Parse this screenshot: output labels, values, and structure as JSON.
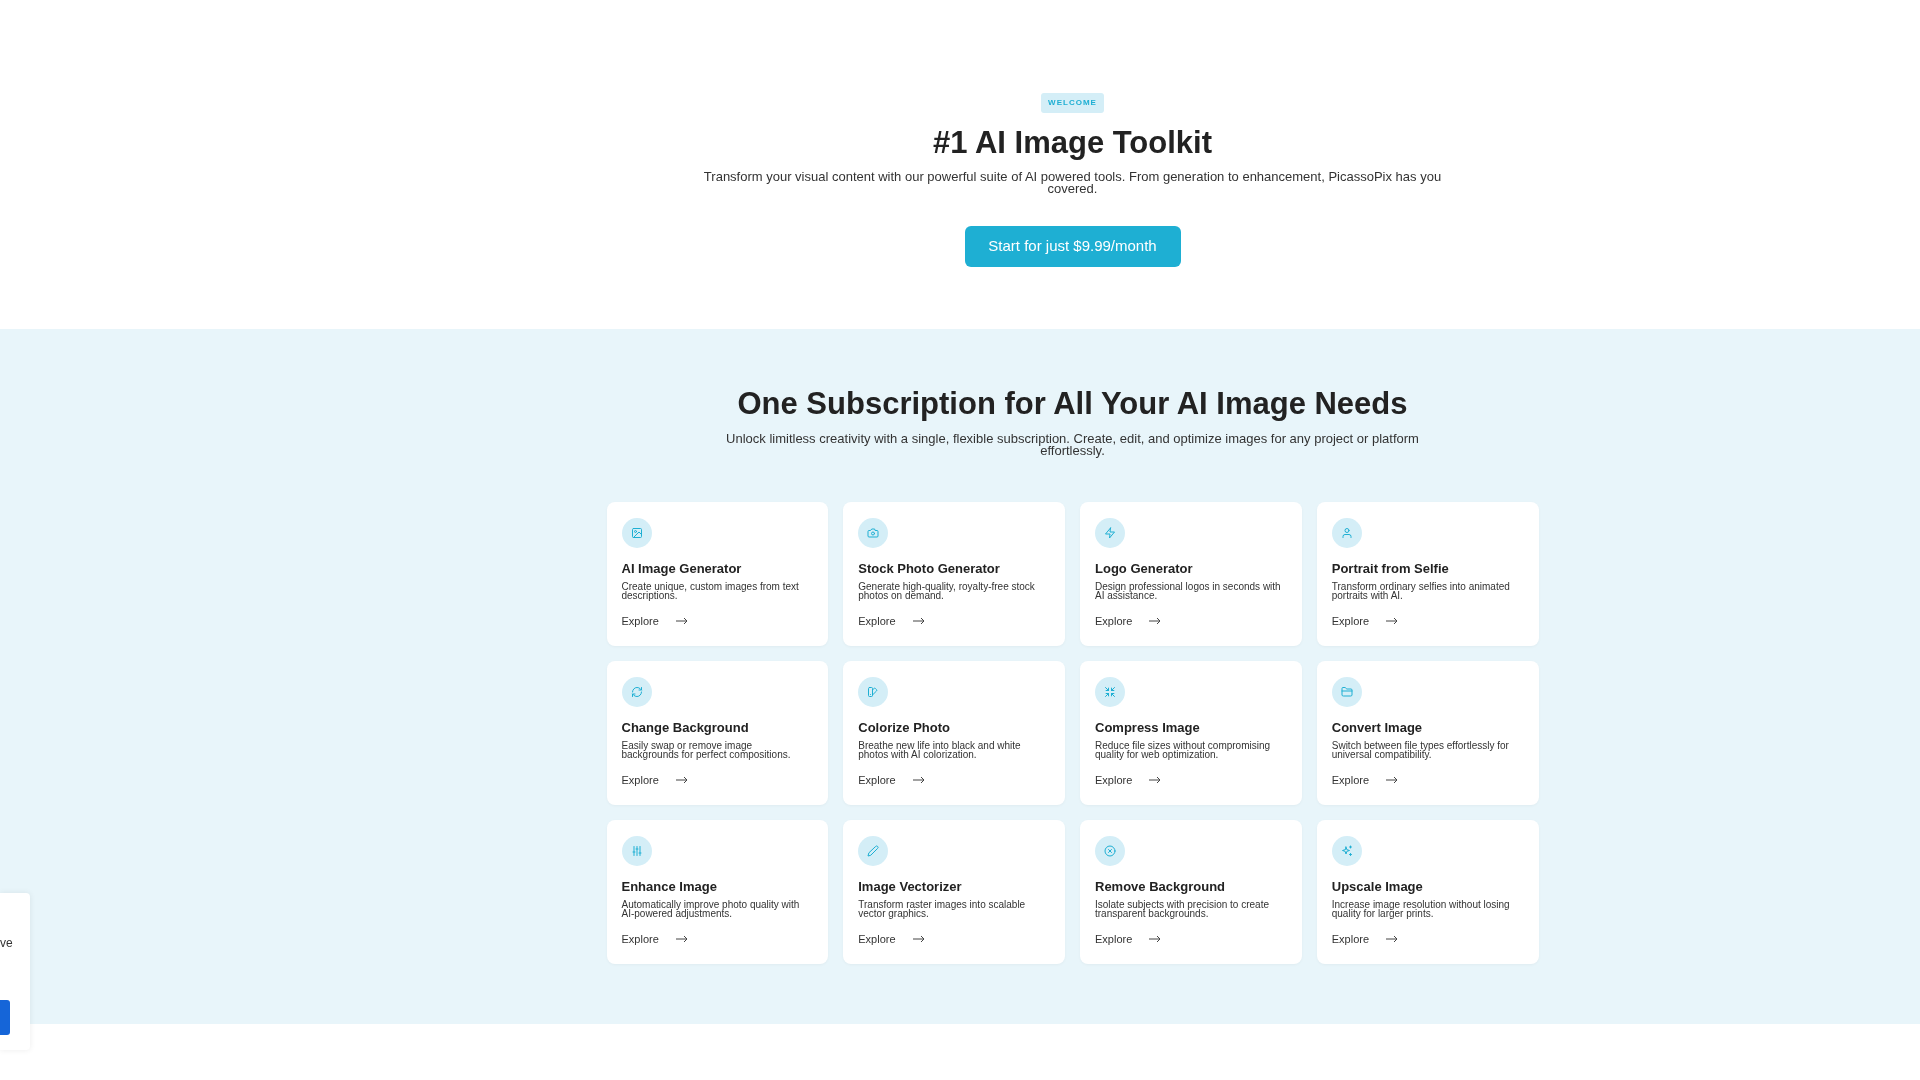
{
  "hero": {
    "badge": "WELCOME",
    "title": "#1 AI Image Toolkit",
    "subtitle": "Transform your visual content with our powerful suite of AI powered tools. From generation to enhancement, PicassoPix has you covered.",
    "cta_button": "Start for just $9.99/month"
  },
  "features": {
    "title": "One Subscription for All Your AI Image Needs",
    "subtitle": "Unlock limitless creativity with a single, flexible subscription. Create, edit, and optimize images for any project or platform effortlessly.",
    "cards": [
      {
        "title": "AI Image Generator",
        "description": "Create unique, custom images from text descriptions.",
        "link": "Explore"
      },
      {
        "title": "Stock Photo Generator",
        "description": "Generate high-quality, royalty-free stock photos on demand.",
        "link": "Explore"
      },
      {
        "title": "Logo Generator",
        "description": "Design professional logos in seconds with AI assistance.",
        "link": "Explore"
      },
      {
        "title": "Portrait from Selfie",
        "description": "Transform ordinary selfies into animated portraits with AI.",
        "link": "Explore"
      },
      {
        "title": "Change Background",
        "description": "Easily swap or remove image backgrounds for perfect compositions.",
        "link": "Explore"
      },
      {
        "title": "Colorize Photo",
        "description": "Breathe new life into black and white photos with AI colorization.",
        "link": "Explore"
      },
      {
        "title": "Compress Image",
        "description": "Reduce file sizes without compromising quality for web optimization.",
        "link": "Explore"
      },
      {
        "title": "Convert Image",
        "description": "Switch between file types effortlessly for universal compatibility.",
        "link": "Explore"
      },
      {
        "title": "Enhance Image",
        "description": "Automatically improve photo quality with AI-powered adjustments.",
        "link": "Explore"
      },
      {
        "title": "Image Vectorizer",
        "description": "Transform raster images into scalable vector graphics.",
        "link": "Explore"
      },
      {
        "title": "Remove Background",
        "description": "Isolate subjects with precision to create transparent backgrounds.",
        "link": "Explore"
      },
      {
        "title": "Upscale Image",
        "description": "Increase image resolution without losing quality for larger prints.",
        "link": "Explore"
      }
    ]
  },
  "popup": {
    "text": "ve"
  }
}
